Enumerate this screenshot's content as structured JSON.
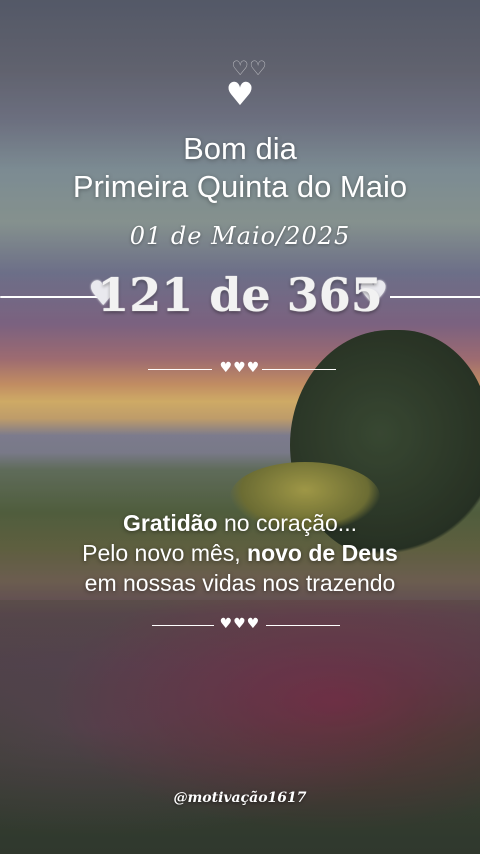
{
  "greeting": {
    "line1": "Bom dia",
    "line2": "Primeira Quinta do Maio"
  },
  "date": "01 de Maio/2025",
  "day_count": "121 de 365",
  "message": {
    "part1_bold": "Gratidão",
    "part1_rest": " no coração...",
    "part2_start": "Pelo novo mês, ",
    "part2_bold": "novo de Deus",
    "part3": "em nossas vidas nos trazendo"
  },
  "divider_hearts": "♥♥♥",
  "handle": "@motivação1617",
  "icons": {
    "top_hearts": "heart-icon",
    "side_hearts": "heart-icon"
  },
  "colors": {
    "text": "#ffffff",
    "count": "#f2f2f2"
  }
}
